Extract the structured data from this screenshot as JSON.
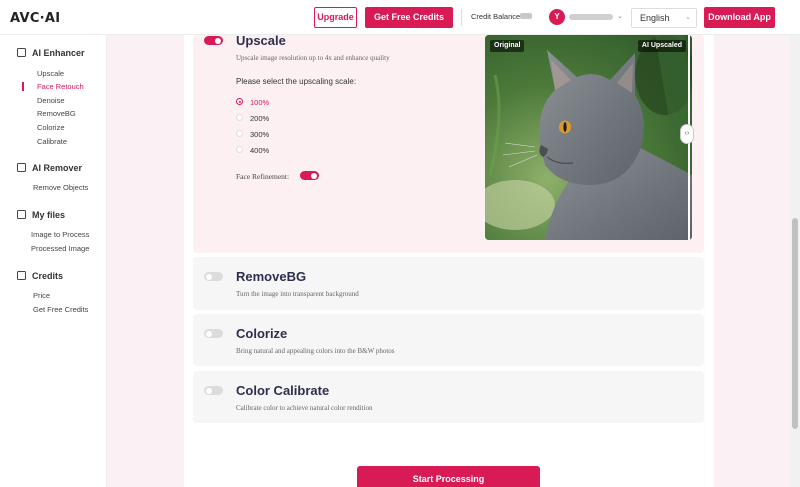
{
  "header": {
    "logo": "AVC·AI",
    "upgrade": "Upgrade",
    "get_free_credits": "Get Free Credits",
    "credit_balance_label": "Credit Balance:",
    "avatar_initial": "Y",
    "language": "English",
    "download_app": "Download App"
  },
  "sidebar": {
    "sections": [
      {
        "title": "AI Enhancer",
        "items": [
          "Upscale",
          "Face Retouch",
          "Denoise",
          "RemoveBG",
          "Colorize",
          "Calibrate"
        ]
      },
      {
        "title": "AI Remover",
        "items": [
          "Remove Objects"
        ]
      },
      {
        "title": "My files",
        "items": [
          "Image to Process",
          "Processed Image"
        ]
      },
      {
        "title": "Credits",
        "items": [
          "Price",
          "Get Free Credits"
        ]
      }
    ],
    "active_item": "Face Retouch"
  },
  "upscale": {
    "title": "Upscale",
    "description": "Upscale image resolution up to 4x and enhance quality",
    "enabled": true,
    "scale_prompt": "Please select the upscaling scale:",
    "scales": [
      "100%",
      "200%",
      "300%",
      "400%"
    ],
    "selected_scale": "100%",
    "face_refinement_label": "Face Refinement:",
    "face_refinement_enabled": true,
    "compare": {
      "left_tag": "Original",
      "right_tag": "AI Upscaled"
    }
  },
  "removebg": {
    "title": "RemoveBG",
    "description": "Turn the image into transparent background",
    "enabled": false
  },
  "colorize": {
    "title": "Colorize",
    "description": "Bring natural and appealing colors into the B&W photos",
    "enabled": false
  },
  "calibrate": {
    "title": "Color Calibrate",
    "description": "Calibrate color to achieve natural color rendition",
    "enabled": false
  },
  "actions": {
    "start_processing": "Start Processing"
  },
  "colors": {
    "accent": "#d81b55",
    "page_bg": "#fbf0f3"
  }
}
